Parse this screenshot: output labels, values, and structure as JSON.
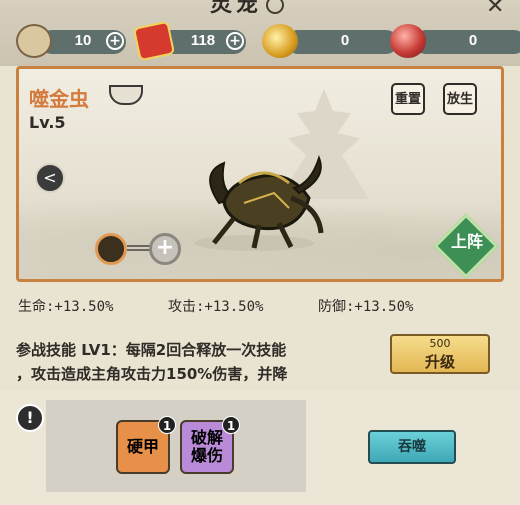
{
  "header": {
    "title_fragment": "灵宠"
  },
  "resources": [
    {
      "name": "rice-sack",
      "value": "10",
      "has_plus": true
    },
    {
      "name": "red-envelope",
      "value": "118",
      "has_plus": true
    },
    {
      "name": "gold-ingot",
      "value": "0",
      "has_plus": false
    },
    {
      "name": "red-orb",
      "value": "0",
      "has_plus": false
    }
  ],
  "pet": {
    "name": "噬金虫",
    "level": "Lv.5",
    "reset_label": "重置",
    "release_label": "放生",
    "deploy_label": "上阵"
  },
  "stats": {
    "hp": "生命:+13.50%",
    "atk": "攻击:+13.50%",
    "def": "防御:+13.50%"
  },
  "skill": {
    "line1": "参战技能 LV1：每隔2回合释放一次技能",
    "line2": "，攻击造成主角攻击力150%伤害，并降"
  },
  "upgrade": {
    "cost": "500",
    "label": "升级"
  },
  "chips": [
    {
      "label": "硬甲",
      "count": "1",
      "color": "#e7904a"
    },
    {
      "label": "破解爆伤",
      "count": "1",
      "color": "#b98ad8"
    }
  ],
  "devour_label": "吞噬"
}
